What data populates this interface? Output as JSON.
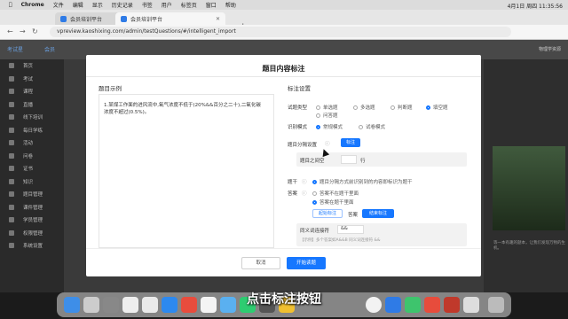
{
  "menubar": {
    "app": "Chrome",
    "items": [
      "文件",
      "编辑",
      "显示",
      "历史记录",
      "书签",
      "用户",
      "标签页",
      "窗口",
      "帮助"
    ],
    "clock": "4月1日 周四 11:35:56"
  },
  "tabs": [
    {
      "label": "会员培训平台"
    },
    {
      "label": "会员培训平台"
    }
  ],
  "address": {
    "url": "vpreview.kaoshixing.com/admin/testQuestions/#/intelligent_import"
  },
  "header": {
    "logo": "考试星",
    "logo2": "会员",
    "user": "物理学资源"
  },
  "sidebar": {
    "items": [
      "首页",
      "考试",
      "课程",
      "直播",
      "线下培训",
      "每日学练",
      "活动",
      "问卷",
      "证书",
      "知识",
      "题目管理",
      "课件管理",
      "学员管理",
      "权限管理",
      "系统设置"
    ]
  },
  "modal": {
    "title": "题目内容标注",
    "left_title": "题目示例",
    "left_text": "1.某煤工作面的进风流中,氧气浓度不低于(20%&&百分之二十),二氧化碳浓度不超过(0.5%)。",
    "right_title": "标注设置",
    "type_label": "试题类型",
    "types": [
      "单选题",
      "多选题",
      "判断题",
      "填空题",
      "问答题"
    ],
    "mode_label": "识别模式",
    "modes": [
      "常规模式",
      "试卷模式"
    ],
    "split_label": "题目分隔设置",
    "mark_btn": "标注",
    "between_label": "题目之间空",
    "between_value": "行",
    "stem_label": "题干",
    "stem_desc": "题目分隔方式前识别到的内容即标识为题干",
    "answer_label": "答案",
    "answer_opt1": "答案不在题干里面",
    "answer_opt2": "答案在题干里面",
    "start_mark": "起始标注",
    "answer_word": "答案",
    "end_mark": "结束标注",
    "sep_label": "同义词连接符",
    "sep_value": "&&",
    "example": "【示例】多个答案如A&&B      同义词连接符 &&",
    "cancel": "取消",
    "start": "开始读题"
  },
  "right_panel": {
    "text": "等一本有趣的题本，让我们发现万物的生机。"
  },
  "caption": "点击标注按钮"
}
